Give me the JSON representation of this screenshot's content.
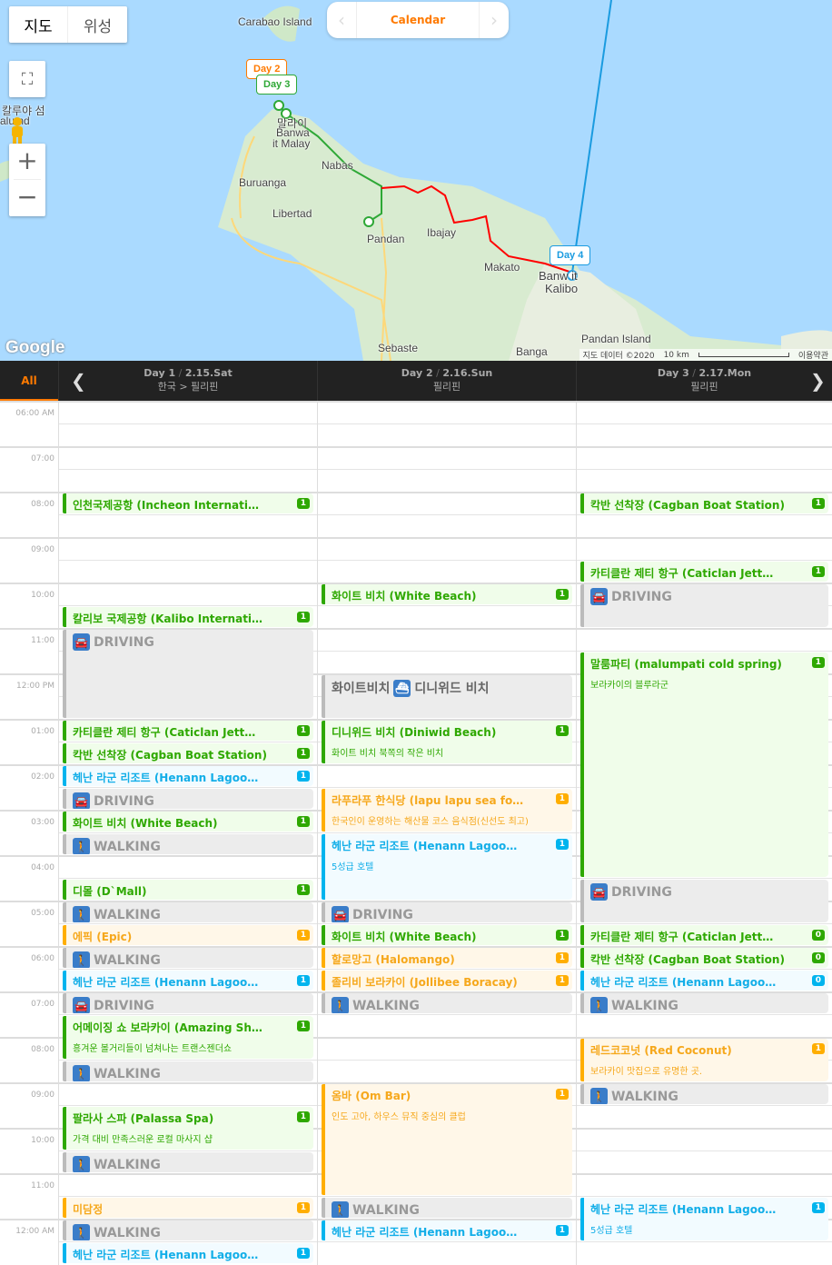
{
  "map": {
    "type_tabs": [
      "지도",
      "위성"
    ],
    "calendar_label": "Calendar",
    "labels": {
      "carabao": "Carabao Island",
      "kaluya": "칼루야 섬",
      "kaluya_en": "alu    nd",
      "malay_ko": "말라이",
      "banwa": "Banwa",
      "malay": "it Malay",
      "nabas": "Nabas",
      "buruanga": "Buruanga",
      "libertad": "Libertad",
      "pandan": "Pandan",
      "ibajay": "Ibajay",
      "makato": "Makato",
      "banwait": "Banw  it",
      "kalibo": "Kalibo",
      "sebaste": "Sebaste",
      "banga": "Banga",
      "pandan_island": "Pandan Island"
    },
    "pins": {
      "day2": "Day 2",
      "day3": "Day 3",
      "day4": "Day 4"
    },
    "google": "Google",
    "attribution": {
      "data": "지도 데이터 ©2020",
      "scale": "10 km",
      "terms": "이용약관"
    }
  },
  "header": {
    "all_label": "All",
    "days": [
      {
        "day": "Day 1",
        "date": "2.15.Sat",
        "place": "한국 > 필리핀"
      },
      {
        "day": "Day 2",
        "date": "2.16.Sun",
        "place": "필리핀"
      },
      {
        "day": "Day 3",
        "date": "2.17.Mon",
        "place": "필리핀"
      }
    ],
    "prev": "❮",
    "next": "❯"
  },
  "times": [
    "06:00 AM",
    "07:00",
    "08:00",
    "09:00",
    "10:00",
    "11:00",
    "12:00 PM",
    "01:00",
    "02:00",
    "03:00",
    "04:00",
    "05:00",
    "06:00",
    "07:00",
    "08:00",
    "09:00",
    "10:00",
    "11:00",
    "12:00 AM"
  ],
  "colors": {
    "green": "#2ea800",
    "orange": "#ffae00",
    "blue": "#00b4ee",
    "accent": "#ff7a00"
  },
  "events": [
    [
      {
        "start": 8,
        "dur": 0.5,
        "kind": "green",
        "title": "인천국제공항 (Incheon Internati…",
        "badge": "1"
      },
      {
        "start": 10.5,
        "dur": 0.5,
        "kind": "green",
        "title": "칼리보 국제공항 (Kalibo Internati…",
        "badge": "1"
      },
      {
        "start": 11,
        "dur": 2,
        "kind": "gray",
        "icon": "car",
        "title": "DRIVING"
      },
      {
        "start": 13,
        "dur": 0.5,
        "kind": "green",
        "title": "카티클란 제티 항구 (Caticlan Jett…",
        "badge": "1"
      },
      {
        "start": 13.5,
        "dur": 0.5,
        "kind": "green",
        "title": "칵반 선착장 (Cagban Boat Station)",
        "badge": "1"
      },
      {
        "start": 14,
        "dur": 0.5,
        "kind": "blue",
        "title": "헤난 라군 리조트 (Henann Lagoo…",
        "badge": "1"
      },
      {
        "start": 14.5,
        "dur": 0.5,
        "kind": "gray",
        "icon": "car",
        "title": "DRIVING"
      },
      {
        "start": 15,
        "dur": 0.5,
        "kind": "green",
        "title": "화이트 비치 (White Beach)",
        "badge": "1"
      },
      {
        "start": 15.5,
        "dur": 0.5,
        "kind": "gray",
        "icon": "walk",
        "title": "WALKING"
      },
      {
        "start": 16.5,
        "dur": 0.5,
        "kind": "green",
        "title": "디몰 (D`Mall)",
        "badge": "1"
      },
      {
        "start": 17,
        "dur": 0.5,
        "kind": "gray",
        "icon": "walk",
        "title": "WALKING"
      },
      {
        "start": 17.5,
        "dur": 0.5,
        "kind": "orange",
        "title": "에픽 (Epic)",
        "badge": "1"
      },
      {
        "start": 18,
        "dur": 0.5,
        "kind": "gray",
        "icon": "walk",
        "title": "WALKING"
      },
      {
        "start": 18.5,
        "dur": 0.5,
        "kind": "blue",
        "title": "헤난 라군 리조트 (Henann Lagoo…",
        "badge": "1"
      },
      {
        "start": 19,
        "dur": 0.5,
        "kind": "gray",
        "icon": "car",
        "title": "DRIVING"
      },
      {
        "start": 19.5,
        "dur": 1,
        "kind": "green",
        "title": "어메이징 쇼 보라카이 (Amazing Sh…",
        "sub": "흥겨운 볼거리들이 넘쳐나는 트랜스젠더쇼",
        "badge": "1"
      },
      {
        "start": 20.5,
        "dur": 0.5,
        "kind": "gray",
        "icon": "walk",
        "title": "WALKING"
      },
      {
        "start": 21.5,
        "dur": 1,
        "kind": "green",
        "title": "팔라사 스파 (Palassa Spa)",
        "sub": "가격 대비 만족스러운 로컬 마사지 샵",
        "badge": "1"
      },
      {
        "start": 22.5,
        "dur": 0.5,
        "kind": "gray",
        "icon": "walk",
        "title": "WALKING"
      },
      {
        "start": 23.5,
        "dur": 0.5,
        "kind": "orange",
        "title": "미담정",
        "badge": "1"
      },
      {
        "start": 24,
        "dur": 0.5,
        "kind": "gray",
        "icon": "walk",
        "title": "WALKING"
      },
      {
        "start": 24.5,
        "dur": 0.5,
        "kind": "blue",
        "title": "헤난 라군 리조트 (Henann Lagoo…",
        "badge": "1"
      }
    ],
    [
      {
        "start": 10,
        "dur": 0.5,
        "kind": "green",
        "title": "화이트 비치 (White Beach)",
        "badge": "1"
      },
      {
        "start": 12,
        "dur": 1,
        "kind": "gray ferry",
        "icon": "ferry",
        "title": "화이트비치",
        "title2": "디니위드 비치"
      },
      {
        "start": 13,
        "dur": 1,
        "kind": "green",
        "title": "디니위드 비치 (Diniwid Beach)",
        "sub": "화이트 비치 북쪽의 작은 비치",
        "badge": "1"
      },
      {
        "start": 14.5,
        "dur": 1,
        "kind": "orange",
        "title": "라푸라푸 한식당 (lapu lapu sea fo…",
        "sub": "한국인이 운영하는 해산물 코스 음식점(신선도 최고)",
        "badge": "1"
      },
      {
        "start": 15.5,
        "dur": 1.5,
        "kind": "blue",
        "title": "헤난 라군 리조트 (Henann Lagoo…",
        "sub": "5성급 호텔",
        "badge": "1"
      },
      {
        "start": 17,
        "dur": 0.5,
        "kind": "gray",
        "icon": "car",
        "title": "DRIVING"
      },
      {
        "start": 17.5,
        "dur": 0.5,
        "kind": "green",
        "title": "화이트 비치 (White Beach)",
        "badge": "1"
      },
      {
        "start": 18,
        "dur": 0.5,
        "kind": "orange",
        "title": "할로망고 (Halomango)",
        "badge": "1"
      },
      {
        "start": 18.5,
        "dur": 0.5,
        "kind": "orange",
        "title": "졸리비 보라카이 (Jollibee Boracay)",
        "badge": "1"
      },
      {
        "start": 19,
        "dur": 0.5,
        "kind": "gray",
        "icon": "walk",
        "title": "WALKING"
      },
      {
        "start": 21,
        "dur": 2.5,
        "kind": "orange",
        "title": "옴바 (Om Bar)",
        "sub": "인도 고아, 하우스 뮤직 중심의 클럽",
        "badge": "1"
      },
      {
        "start": 23.5,
        "dur": 0.5,
        "kind": "gray",
        "icon": "walk",
        "title": "WALKING"
      },
      {
        "start": 24,
        "dur": 0.5,
        "kind": "blue",
        "title": "헤난 라군 리조트 (Henann Lagoo…",
        "badge": "1"
      }
    ],
    [
      {
        "start": 8,
        "dur": 0.5,
        "kind": "green",
        "title": "칵반 선착장 (Cagban Boat Station)",
        "badge": "1"
      },
      {
        "start": 9.5,
        "dur": 0.5,
        "kind": "green",
        "title": "카티클란 제티 항구 (Caticlan Jett…",
        "badge": "1"
      },
      {
        "start": 10,
        "dur": 1,
        "kind": "gray",
        "icon": "car",
        "title": "DRIVING"
      },
      {
        "start": 11.5,
        "dur": 5,
        "kind": "green",
        "title": "말룸파티 (malumpati cold spring)",
        "sub": "보라카이의 블루라군",
        "badge": "1"
      },
      {
        "start": 16.5,
        "dur": 1,
        "kind": "gray",
        "icon": "car",
        "title": "DRIVING"
      },
      {
        "start": 17.5,
        "dur": 0.5,
        "kind": "green",
        "title": "카티클란 제티 항구 (Caticlan Jett…",
        "badge": "0"
      },
      {
        "start": 18,
        "dur": 0.5,
        "kind": "green",
        "title": "칵반 선착장 (Cagban Boat Station)",
        "badge": "0"
      },
      {
        "start": 18.5,
        "dur": 0.5,
        "kind": "blue",
        "title": "헤난 라군 리조트 (Henann Lagoo…",
        "badge": "0"
      },
      {
        "start": 19,
        "dur": 0.5,
        "kind": "gray",
        "icon": "walk",
        "title": "WALKING"
      },
      {
        "start": 20,
        "dur": 1,
        "kind": "orange",
        "title": "레드코코넛 (Red Coconut)",
        "sub": "보라카이 맛집으로 유명한 곳.",
        "badge": "1"
      },
      {
        "start": 21,
        "dur": 0.5,
        "kind": "gray",
        "icon": "walk",
        "title": "WALKING"
      },
      {
        "start": 23.5,
        "dur": 1,
        "kind": "blue",
        "title": "헤난 라군 리조트 (Henann Lagoo…",
        "sub": "5성급 호텔",
        "badge": "1"
      }
    ]
  ]
}
